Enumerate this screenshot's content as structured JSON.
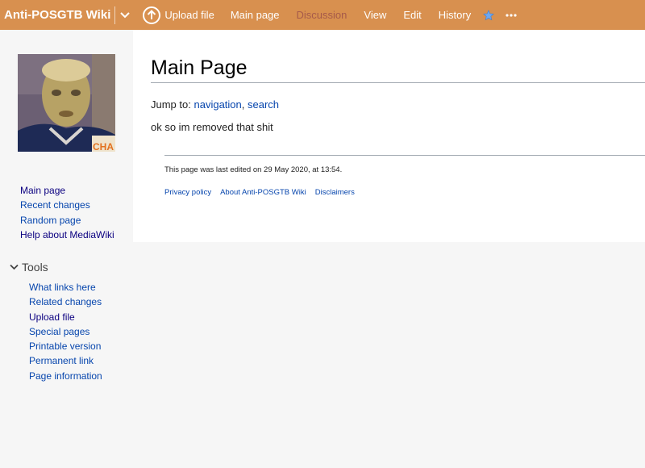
{
  "header": {
    "site_name": "Anti-POSGTB Wiki",
    "upload_label": "Upload file",
    "links": [
      "Main page",
      "Discussion",
      "View",
      "Edit",
      "History"
    ],
    "bg_color": "#d8904f",
    "star_color": "#36c"
  },
  "sidebar": {
    "logo_text": "CHA",
    "nav": [
      "Main page",
      "Recent changes",
      "Random page",
      "Help about MediaWiki"
    ],
    "tools_label": "Tools",
    "tools": [
      "What links here",
      "Related changes",
      "Upload file",
      "Special pages",
      "Printable version",
      "Permanent link",
      "Page information"
    ]
  },
  "content": {
    "title": "Main Page",
    "jump_prefix": "Jump to:",
    "jump_nav": "navigation",
    "jump_sep": ",",
    "jump_search": "search",
    "body": "ok so im removed that shit"
  },
  "footer": {
    "last_modified": "This page was last edited on 29 May 2020, at 13:54.",
    "links": [
      "Privacy policy",
      "About Anti-POSGTB Wiki",
      "Disclaimers"
    ]
  }
}
